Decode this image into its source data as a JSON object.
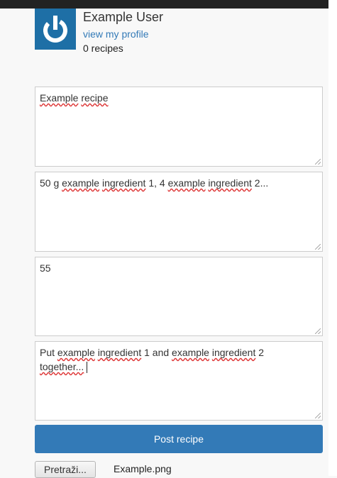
{
  "profile": {
    "name": "Example User",
    "profile_link": "view my profile",
    "recipe_count": "0 recipes",
    "avatar_icon": "power-icon",
    "avatar_color": "#1e6fa6"
  },
  "form": {
    "title_words": [
      "Example",
      "recipe"
    ],
    "ingredients_words": [
      "50 g",
      "example",
      "ingredient",
      "1, 4",
      "example",
      "ingredient",
      "2..."
    ],
    "time_value": "55",
    "instructions_words": [
      "Put",
      "example",
      "ingredient",
      "1 and",
      "example",
      "ingredient",
      "2",
      "together..."
    ],
    "post_button": "Post recipe",
    "browse_button": "Pretraži...",
    "file_name": "Example.png"
  },
  "colors": {
    "accent": "#337ab7",
    "spellcheck_underline": "#dd3333"
  }
}
